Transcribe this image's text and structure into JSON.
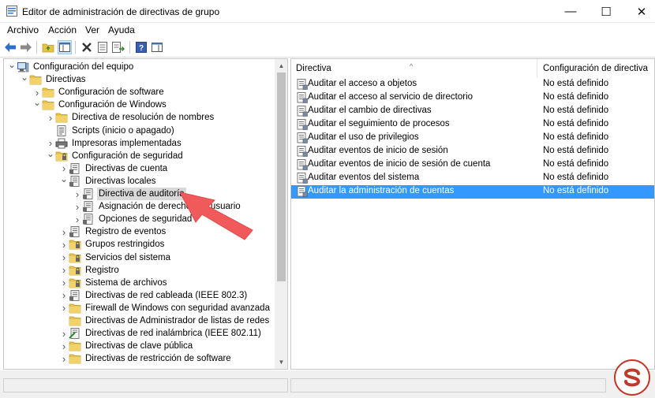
{
  "window": {
    "title": "Editor de administración de directivas de grupo",
    "minimize_glyph": "—",
    "maximize_glyph": "☐",
    "close_glyph": "✕"
  },
  "menu": {
    "items": [
      "Archivo",
      "Acción",
      "Ver",
      "Ayuda"
    ]
  },
  "toolbar": {
    "icons": [
      "back-icon",
      "forward-icon",
      "up-folder-icon",
      "show-hide-tree-icon",
      "delete-icon",
      "properties-icon",
      "export-list-icon",
      "help-icon",
      "show-hide-action-pane-icon"
    ]
  },
  "tree": {
    "items": [
      {
        "label": "Configuración del equipo",
        "level": 0,
        "expander": "open",
        "icon": "computer-icon"
      },
      {
        "label": "Directivas",
        "level": 1,
        "expander": "open",
        "icon": "folder-icon"
      },
      {
        "label": "Configuración de software",
        "level": 2,
        "expander": "closed",
        "icon": "folder-icon"
      },
      {
        "label": "Configuración de Windows",
        "level": 2,
        "expander": "open",
        "icon": "folder-icon"
      },
      {
        "label": "Directiva de resolución de nombres",
        "level": 3,
        "expander": "closed",
        "icon": "folder-icon"
      },
      {
        "label": "Scripts (inicio o apagado)",
        "level": 3,
        "expander": "none",
        "icon": "script-icon"
      },
      {
        "label": "Impresoras implementadas",
        "level": 3,
        "expander": "closed",
        "icon": "printer-icon"
      },
      {
        "label": "Configuración de seguridad",
        "level": 3,
        "expander": "open",
        "icon": "security-folder-icon"
      },
      {
        "label": "Directivas de cuenta",
        "level": 4,
        "expander": "closed",
        "icon": "policy-icon"
      },
      {
        "label": "Directivas locales",
        "level": 4,
        "expander": "open",
        "icon": "policy-icon"
      },
      {
        "label": "Directiva de auditoría",
        "level": 5,
        "expander": "closed",
        "icon": "policy-icon",
        "selected": true
      },
      {
        "label": "Asignación de derechos de usuario",
        "level": 5,
        "expander": "closed",
        "icon": "policy-icon"
      },
      {
        "label": "Opciones de seguridad",
        "level": 5,
        "expander": "closed",
        "icon": "policy-icon"
      },
      {
        "label": "Registro de eventos",
        "level": 4,
        "expander": "closed",
        "icon": "policy-icon"
      },
      {
        "label": "Grupos restringidos",
        "level": 4,
        "expander": "closed",
        "icon": "security-folder-icon"
      },
      {
        "label": "Servicios del sistema",
        "level": 4,
        "expander": "closed",
        "icon": "security-folder-icon"
      },
      {
        "label": "Registro",
        "level": 4,
        "expander": "closed",
        "icon": "security-folder-icon"
      },
      {
        "label": "Sistema de archivos",
        "level": 4,
        "expander": "closed",
        "icon": "security-folder-icon"
      },
      {
        "label": "Directivas de red cableada (IEEE 802.3)",
        "level": 4,
        "expander": "closed",
        "icon": "policy-icon"
      },
      {
        "label": "Firewall de Windows con seguridad avanzada",
        "level": 4,
        "expander": "closed",
        "icon": "folder-icon"
      },
      {
        "label": "Directivas de Administrador de listas de redes",
        "level": 4,
        "expander": "none",
        "icon": "folder-icon"
      },
      {
        "label": "Directivas de red inalámbrica (IEEE 802.11)",
        "level": 4,
        "expander": "closed",
        "icon": "wireless-policy-icon"
      },
      {
        "label": "Directivas de clave pública",
        "level": 4,
        "expander": "closed",
        "icon": "folder-icon"
      },
      {
        "label": "Directivas de restricción de software",
        "level": 4,
        "expander": "closed",
        "icon": "folder-icon"
      }
    ]
  },
  "list": {
    "columns": [
      "Directiva",
      "Configuración de directiva"
    ],
    "rows": [
      {
        "name": "Auditar el acceso a objetos",
        "setting": "No está definido"
      },
      {
        "name": "Auditar el acceso al servicio de directorio",
        "setting": "No está definido"
      },
      {
        "name": "Auditar el cambio de directivas",
        "setting": "No está definido"
      },
      {
        "name": "Auditar el seguimiento de procesos",
        "setting": "No está definido"
      },
      {
        "name": "Auditar el uso de privilegios",
        "setting": "No está definido"
      },
      {
        "name": "Auditar eventos de inicio de sesión",
        "setting": "No está definido"
      },
      {
        "name": "Auditar eventos de inicio de sesión de cuenta",
        "setting": "No está definido"
      },
      {
        "name": "Auditar eventos del sistema",
        "setting": "No está definido"
      },
      {
        "name": "Auditar la administración de cuentas",
        "setting": "No está definido",
        "selected": true
      }
    ]
  },
  "colors": {
    "selection_blue": "#3399ff",
    "tree_selected": "#d9d9d9",
    "annotation_arrow": "#f05a5a",
    "folder_yellow": "#e8c34a"
  }
}
